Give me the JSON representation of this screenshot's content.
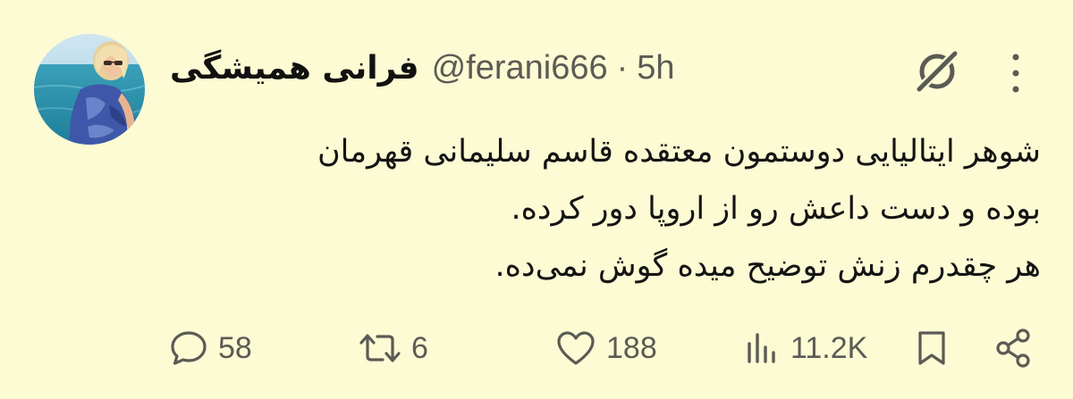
{
  "tweet": {
    "display_name": "فرانی همیشگی",
    "handle": "@ferani666",
    "separator": "·",
    "time": "5h",
    "body_lines": [
      "شوهر ایتالیایی دوستمون معتقده قاسم سلیمانی قهرمان",
      "بوده و دست داعش رو از اروپا دور کرده.",
      "هر چقدرم زنش توضیح میده گوش نمی‌ده."
    ]
  },
  "header_icons": {
    "grok": "grok-icon",
    "more": "more-vertical-icon"
  },
  "actions": {
    "replies": {
      "icon": "reply-icon",
      "count": "58"
    },
    "reposts": {
      "icon": "repost-icon",
      "count": "6"
    },
    "likes": {
      "icon": "heart-icon",
      "count": "188"
    },
    "views": {
      "icon": "views-icon",
      "count": "11.2K"
    },
    "bookmark": {
      "icon": "bookmark-icon"
    },
    "share": {
      "icon": "share-icon"
    }
  },
  "colors": {
    "background": "#fdfbd4",
    "text": "#141414",
    "muted": "#5b5b55"
  }
}
